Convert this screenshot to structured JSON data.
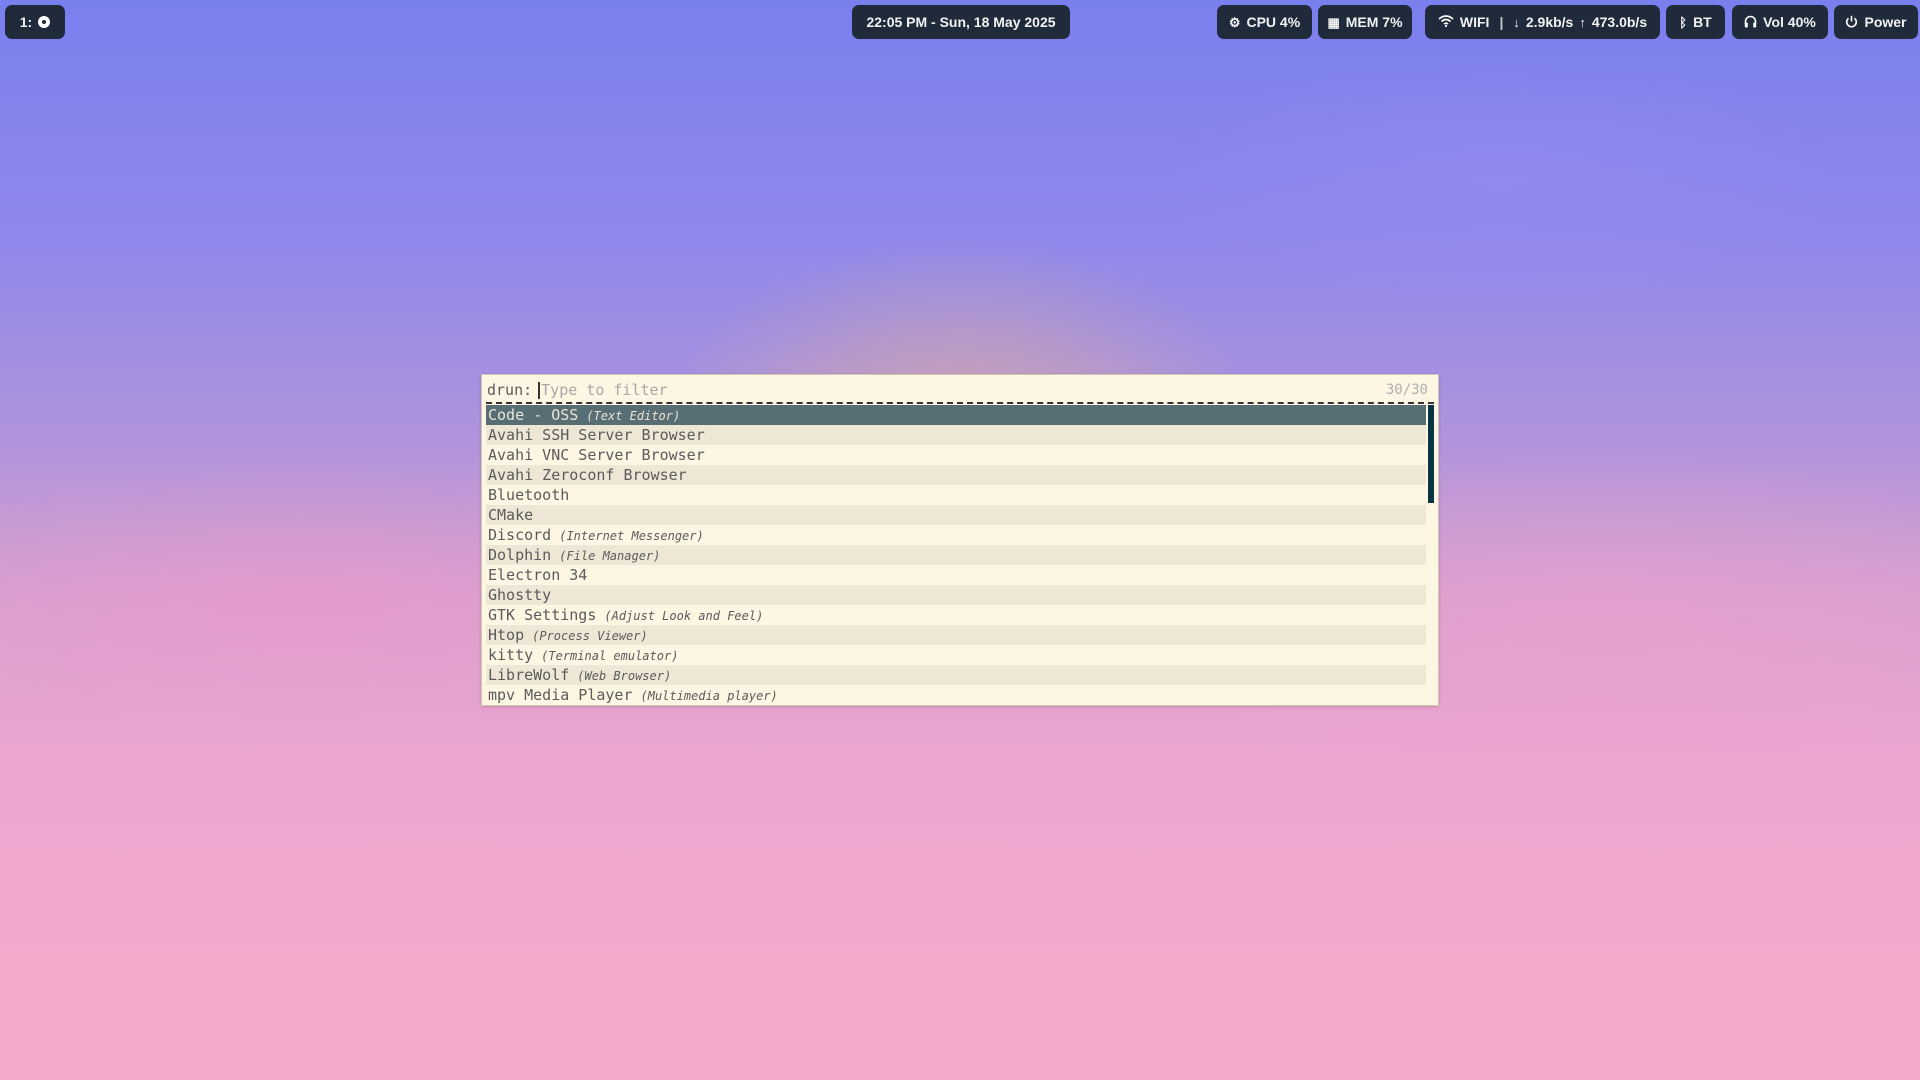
{
  "topbar": {
    "workspace": {
      "label": "1:"
    },
    "clock": "22:05 PM - Sun, 18 May 2025",
    "cpu": {
      "icon": "cpu-icon",
      "label": "CPU 4%"
    },
    "mem": {
      "icon": "memory-icon",
      "label": "MEM 7%"
    },
    "network": {
      "icon": "wifi-icon",
      "label": "WIFI",
      "separator": "|",
      "down": "2.9kb/s",
      "up": "473.0b/s"
    },
    "bluetooth": {
      "icon": "bluetooth-icon",
      "label": "BT"
    },
    "volume": {
      "icon": "headphones-icon",
      "label": "Vol 40%"
    },
    "power": {
      "icon": "power-icon",
      "label": "Power"
    }
  },
  "launcher": {
    "prompt": "drun:",
    "placeholder": "Type to filter",
    "counter": "30/30",
    "items": [
      {
        "name": "Code - OSS",
        "desc": "(Text Editor)",
        "selected": true
      },
      {
        "name": "Avahi SSH Server Browser",
        "desc": ""
      },
      {
        "name": "Avahi VNC Server Browser",
        "desc": ""
      },
      {
        "name": "Avahi Zeroconf Browser",
        "desc": ""
      },
      {
        "name": "Bluetooth",
        "desc": ""
      },
      {
        "name": "CMake",
        "desc": ""
      },
      {
        "name": "Discord",
        "desc": "(Internet Messenger)"
      },
      {
        "name": "Dolphin",
        "desc": "(File Manager)"
      },
      {
        "name": "Electron 34",
        "desc": ""
      },
      {
        "name": "Ghostty",
        "desc": ""
      },
      {
        "name": "GTK Settings",
        "desc": "(Adjust Look and Feel)"
      },
      {
        "name": "Htop",
        "desc": "(Process Viewer)"
      },
      {
        "name": "kitty",
        "desc": "(Terminal emulator)"
      },
      {
        "name": "LibreWolf",
        "desc": "(Web Browser)"
      },
      {
        "name": "mpv Media Player",
        "desc": "(Multimedia player)"
      }
    ]
  },
  "colors": {
    "bar_bg": "#1f2a3a",
    "launcher_bg": "#fdf6e3",
    "selected_bg": "#586e75",
    "scrollbar": "#073642"
  }
}
